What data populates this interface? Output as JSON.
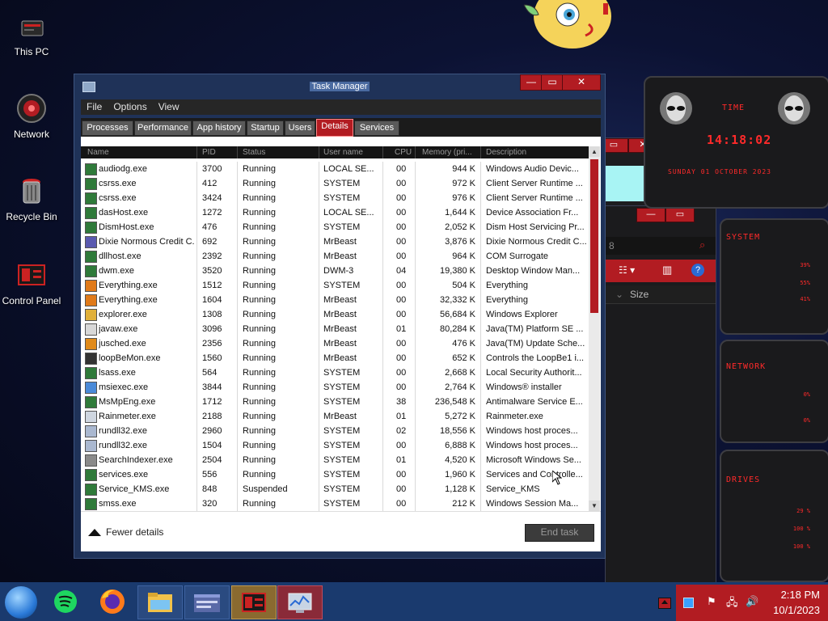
{
  "desktop": {
    "icons": [
      {
        "label": "This PC",
        "icon": "computer-icon"
      },
      {
        "label": "Network",
        "icon": "network-icon"
      },
      {
        "label": "Recycle Bin",
        "icon": "recycle-bin-icon"
      },
      {
        "label": "Control Panel",
        "icon": "control-panel-icon"
      }
    ]
  },
  "rainmeter": {
    "time_title": "TIME",
    "clock": "14:18:02",
    "date": "SUNDAY 01 OCTOBER 2023",
    "system_title": "SYSTEM",
    "system_values": [
      "39%",
      "55%",
      "41%"
    ],
    "network_title": "NETWORK",
    "network_values": [
      "0%",
      "0%"
    ],
    "drives_title": "DRIVES",
    "drives_values": [
      "29 %",
      "100 %",
      "100 %"
    ]
  },
  "explorer_fragment": {
    "search_value": "8",
    "column_size": "Size"
  },
  "task_manager": {
    "title": "Task Manager",
    "menu": [
      "File",
      "Options",
      "View"
    ],
    "tabs": [
      "Processes",
      "Performance",
      "App history",
      "Startup",
      "Users",
      "Details",
      "Services"
    ],
    "active_tab": "Details",
    "columns": [
      "Name",
      "PID",
      "Status",
      "User name",
      "CPU",
      "Memory (pri...",
      "Description"
    ],
    "rows": [
      {
        "name": "audiodg.exe",
        "pid": "3700",
        "status": "Running",
        "user": "LOCAL SE...",
        "cpu": "00",
        "mem": "944 K",
        "desc": "Windows Audio Devic..."
      },
      {
        "name": "csrss.exe",
        "pid": "412",
        "status": "Running",
        "user": "SYSTEM",
        "cpu": "00",
        "mem": "972 K",
        "desc": "Client Server Runtime ..."
      },
      {
        "name": "csrss.exe",
        "pid": "3424",
        "status": "Running",
        "user": "SYSTEM",
        "cpu": "00",
        "mem": "976 K",
        "desc": "Client Server Runtime ..."
      },
      {
        "name": "dasHost.exe",
        "pid": "1272",
        "status": "Running",
        "user": "LOCAL SE...",
        "cpu": "00",
        "mem": "1,644 K",
        "desc": "Device Association Fr..."
      },
      {
        "name": "DismHost.exe",
        "pid": "476",
        "status": "Running",
        "user": "SYSTEM",
        "cpu": "00",
        "mem": "2,052 K",
        "desc": "Dism Host Servicing Pr..."
      },
      {
        "name": "Dixie Normous Credit C...",
        "pid": "692",
        "status": "Running",
        "user": "MrBeast",
        "cpu": "00",
        "mem": "3,876 K",
        "desc": "Dixie Normous Credit C..."
      },
      {
        "name": "dllhost.exe",
        "pid": "2392",
        "status": "Running",
        "user": "MrBeast",
        "cpu": "00",
        "mem": "964 K",
        "desc": "COM Surrogate"
      },
      {
        "name": "dwm.exe",
        "pid": "3520",
        "status": "Running",
        "user": "DWM-3",
        "cpu": "04",
        "mem": "19,380 K",
        "desc": "Desktop Window Man..."
      },
      {
        "name": "Everything.exe",
        "pid": "1512",
        "status": "Running",
        "user": "SYSTEM",
        "cpu": "00",
        "mem": "504 K",
        "desc": "Everything"
      },
      {
        "name": "Everything.exe",
        "pid": "1604",
        "status": "Running",
        "user": "MrBeast",
        "cpu": "00",
        "mem": "32,332 K",
        "desc": "Everything"
      },
      {
        "name": "explorer.exe",
        "pid": "1308",
        "status": "Running",
        "user": "MrBeast",
        "cpu": "00",
        "mem": "56,684 K",
        "desc": "Windows Explorer"
      },
      {
        "name": "javaw.exe",
        "pid": "3096",
        "status": "Running",
        "user": "MrBeast",
        "cpu": "01",
        "mem": "80,284 K",
        "desc": "Java(TM) Platform SE ..."
      },
      {
        "name": "jusched.exe",
        "pid": "2356",
        "status": "Running",
        "user": "MrBeast",
        "cpu": "00",
        "mem": "476 K",
        "desc": "Java(TM) Update Sche..."
      },
      {
        "name": "loopBeMon.exe",
        "pid": "1560",
        "status": "Running",
        "user": "MrBeast",
        "cpu": "00",
        "mem": "652 K",
        "desc": "Controls the LoopBe1 i..."
      },
      {
        "name": "lsass.exe",
        "pid": "564",
        "status": "Running",
        "user": "SYSTEM",
        "cpu": "00",
        "mem": "2,668 K",
        "desc": "Local Security Authorit..."
      },
      {
        "name": "msiexec.exe",
        "pid": "3844",
        "status": "Running",
        "user": "SYSTEM",
        "cpu": "00",
        "mem": "2,764 K",
        "desc": "Windows® installer"
      },
      {
        "name": "MsMpEng.exe",
        "pid": "1712",
        "status": "Running",
        "user": "SYSTEM",
        "cpu": "38",
        "mem": "236,548 K",
        "desc": "Antimalware Service E..."
      },
      {
        "name": "Rainmeter.exe",
        "pid": "2188",
        "status": "Running",
        "user": "MrBeast",
        "cpu": "01",
        "mem": "5,272 K",
        "desc": "Rainmeter.exe"
      },
      {
        "name": "rundll32.exe",
        "pid": "2960",
        "status": "Running",
        "user": "SYSTEM",
        "cpu": "02",
        "mem": "18,556 K",
        "desc": "Windows host proces..."
      },
      {
        "name": "rundll32.exe",
        "pid": "1504",
        "status": "Running",
        "user": "SYSTEM",
        "cpu": "00",
        "mem": "6,888 K",
        "desc": "Windows host proces..."
      },
      {
        "name": "SearchIndexer.exe",
        "pid": "2504",
        "status": "Running",
        "user": "SYSTEM",
        "cpu": "01",
        "mem": "4,520 K",
        "desc": "Microsoft Windows Se..."
      },
      {
        "name": "services.exe",
        "pid": "556",
        "status": "Running",
        "user": "SYSTEM",
        "cpu": "00",
        "mem": "1,960 K",
        "desc": "Services and Controlle..."
      },
      {
        "name": "Service_KMS.exe",
        "pid": "848",
        "status": "Suspended",
        "user": "SYSTEM",
        "cpu": "00",
        "mem": "1,128 K",
        "desc": "Service_KMS"
      },
      {
        "name": "smss.exe",
        "pid": "320",
        "status": "Running",
        "user": "SYSTEM",
        "cpu": "00",
        "mem": "212 K",
        "desc": "Windows Session Ma..."
      }
    ],
    "fewer_details": "Fewer details",
    "end_task": "End task"
  },
  "taskbar": {
    "items": [
      "start-orb-icon",
      "spotify-icon",
      "firefox-icon",
      "file-explorer-icon",
      "window-icon",
      "control-panel-icon",
      "task-manager-icon"
    ],
    "time": "2:18 PM",
    "date": "10/1/2023"
  },
  "colors": {
    "accent": "#b21c22",
    "taskbar": "#1a3a6e",
    "window_frame": "#1f3258"
  }
}
